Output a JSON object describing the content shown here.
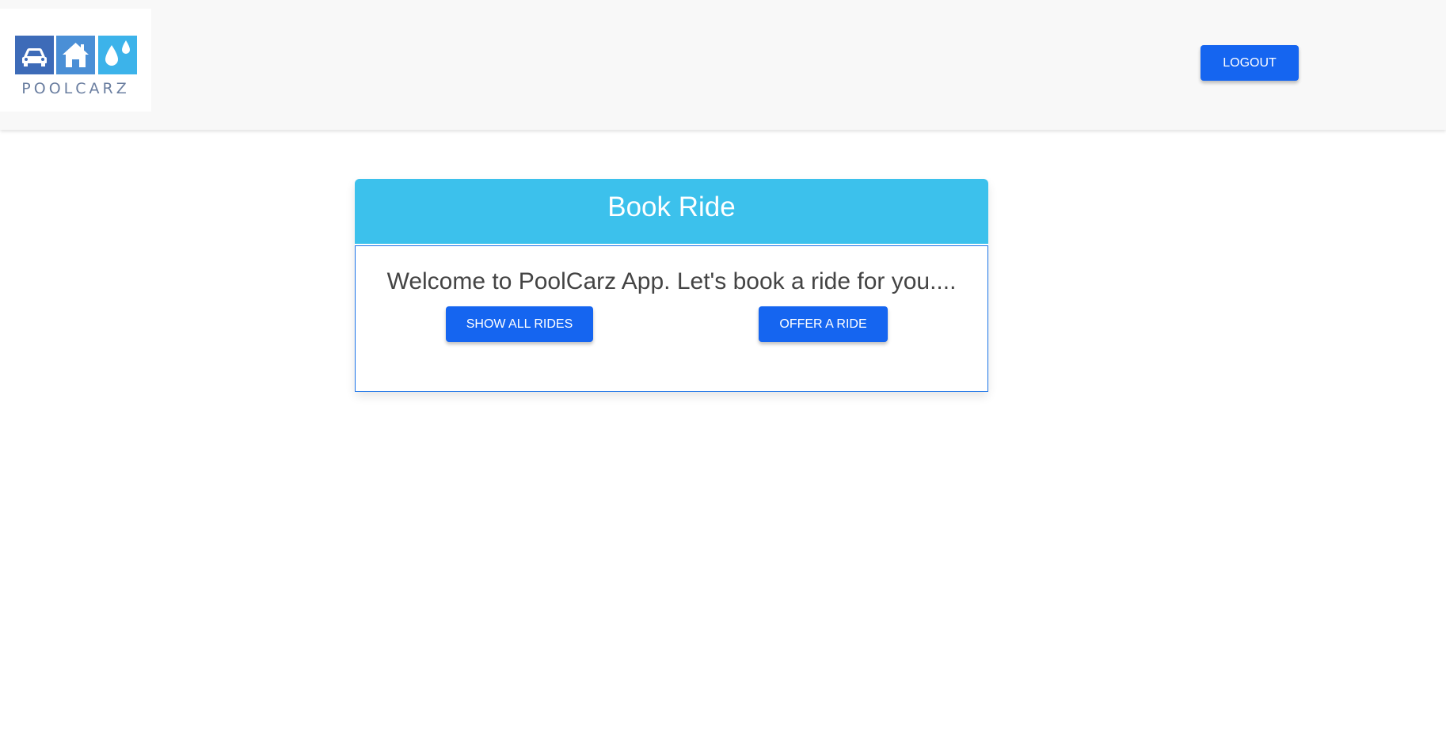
{
  "header": {
    "logo_text": "POOLCARZ",
    "logo_icons": [
      "car-icon",
      "house-icon",
      "water-drops-icon"
    ],
    "logout_label": "LOGOUT"
  },
  "card": {
    "title": "Book Ride",
    "welcome_text": "Welcome to PoolCarz App. Let's book a ride for you....",
    "show_all_label": "SHOW ALL RIDES",
    "offer_label": "OFFER A RIDE"
  },
  "colors": {
    "primary_button": "#1565f0",
    "card_header": "#3cc1ec",
    "navbar_bg": "#f8f8f8",
    "logo_tile_car": "#3d6bb8",
    "logo_tile_house": "#4a8fd6",
    "logo_tile_drops": "#3cb3ea"
  }
}
